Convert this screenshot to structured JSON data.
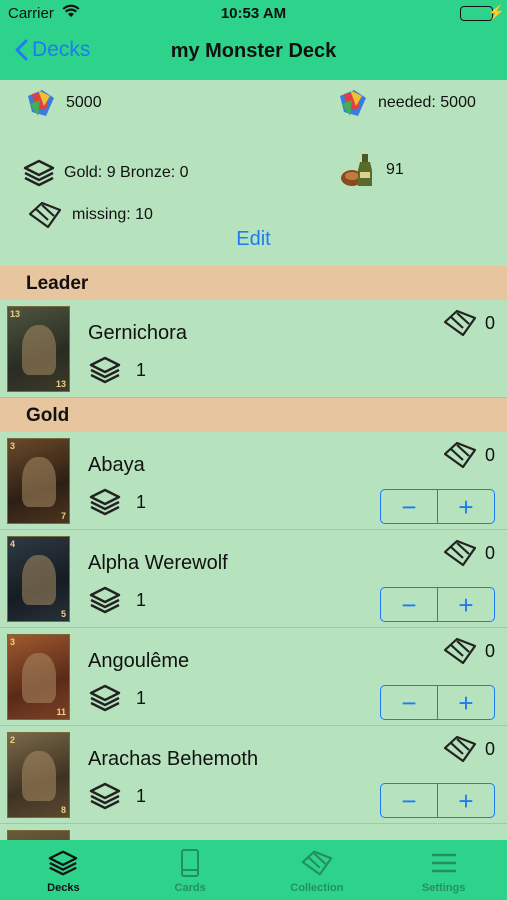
{
  "status": {
    "carrier": "Carrier",
    "time": "10:53 AM"
  },
  "nav": {
    "back_label": "Decks",
    "title": "my Monster Deck"
  },
  "summary": {
    "scraps": "5000",
    "needed": "needed: 5000",
    "cards": "Gold: 9 Bronze: 0",
    "provisions": "91",
    "missing": "missing: 10",
    "edit_label": "Edit"
  },
  "sections": {
    "leader": "Leader",
    "gold": "Gold"
  },
  "leader": {
    "name": "Gernichora",
    "count": "1",
    "owned": "0",
    "badge_top": "13",
    "badge_bottom": "13"
  },
  "gold_cards": [
    {
      "name": "Abaya",
      "count": "1",
      "owned": "0",
      "badge_top": "3",
      "badge_bottom": "7"
    },
    {
      "name": "Alpha Werewolf",
      "count": "1",
      "owned": "0",
      "badge_top": "4",
      "badge_bottom": "5"
    },
    {
      "name": "Angoulême",
      "count": "1",
      "owned": "0",
      "badge_top": "3",
      "badge_bottom": "11"
    },
    {
      "name": "Arachas Behemoth",
      "count": "1",
      "owned": "0",
      "badge_top": "2",
      "badge_bottom": "8"
    }
  ],
  "stepper": {
    "minus": "−",
    "plus": "+"
  },
  "tabs": [
    {
      "label": "Decks",
      "icon": "layers-icon"
    },
    {
      "label": "Cards",
      "icon": "card-icon"
    },
    {
      "label": "Collection",
      "icon": "cards-outline-icon"
    },
    {
      "label": "Settings",
      "icon": "list-icon"
    }
  ],
  "colors": {
    "header": "#2dd38a",
    "body": "#b6e3bd",
    "section": "#e6c59f",
    "accent": "#1e7bf3"
  }
}
